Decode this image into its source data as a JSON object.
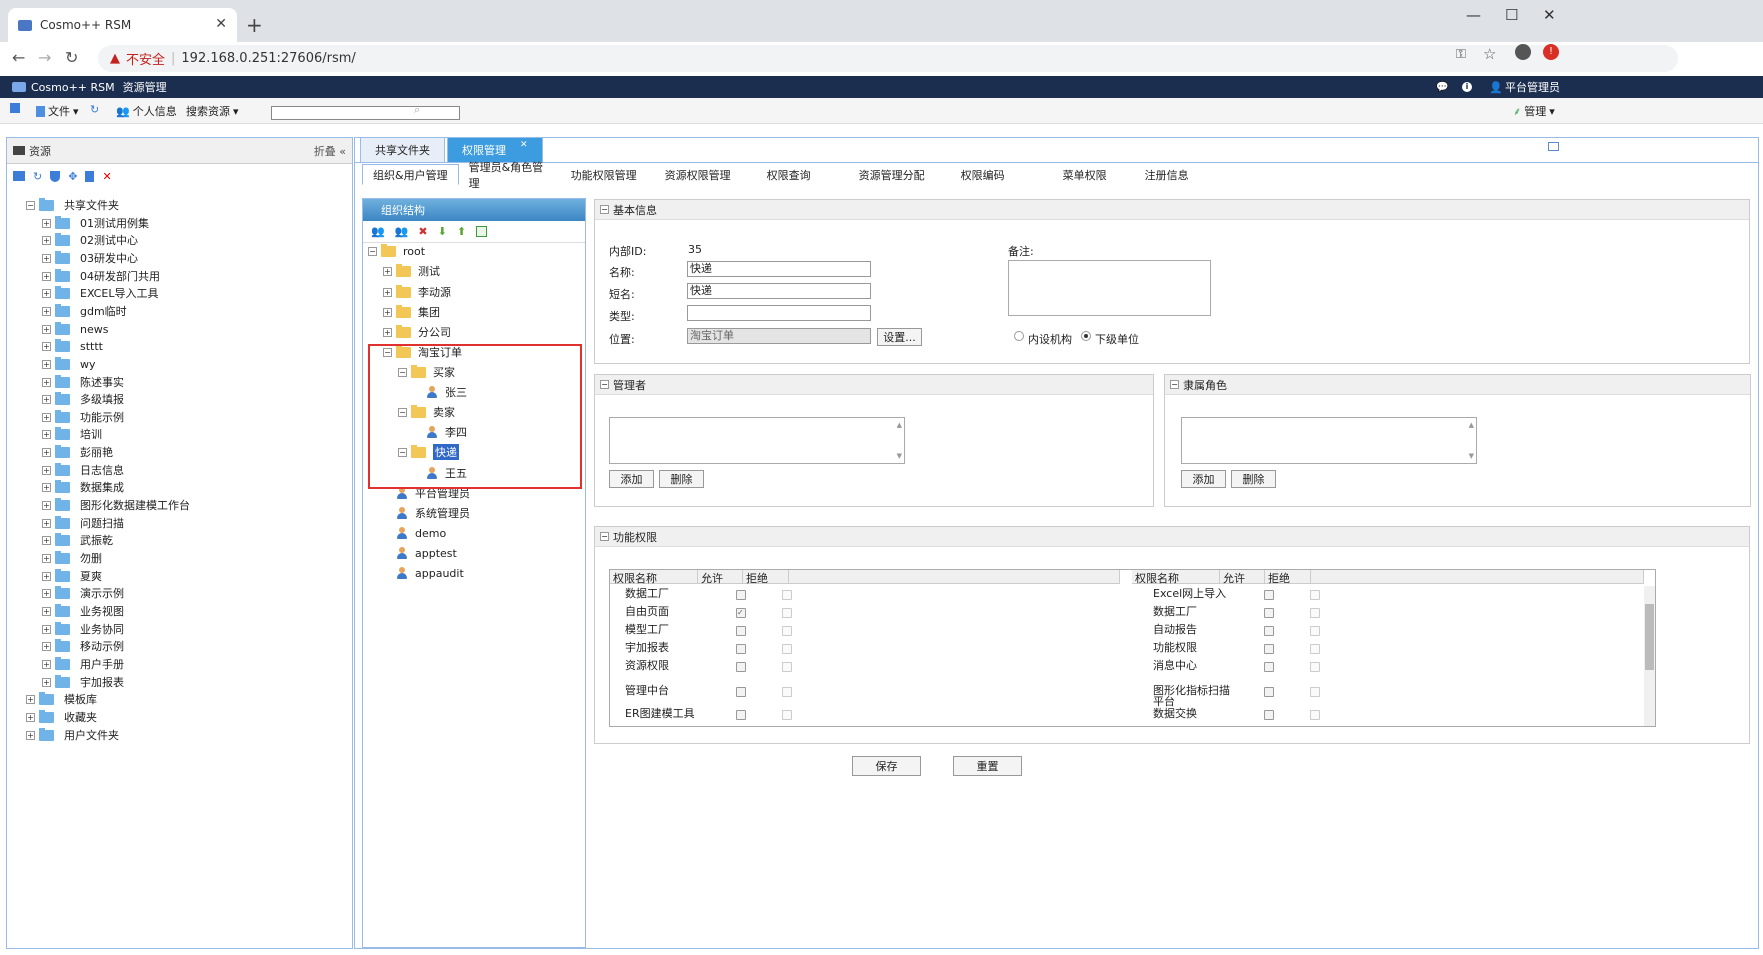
{
  "browser": {
    "tab_title": "Cosmo++ RSM",
    "security_label": "不安全",
    "url": "192.168.0.251:27606/rsm/"
  },
  "app": {
    "title": "Cosmo++ RSM",
    "module": "资源管理",
    "user": "平台管理员"
  },
  "toolbar": {
    "file": "文件",
    "profile": "个人信息",
    "search_label": "搜索资源",
    "search_value": "",
    "manage": "管理"
  },
  "left_panel": {
    "title": "资源",
    "collapse": "折叠",
    "items": [
      {
        "label": "共享文件夹"
      },
      {
        "label": "01测试用例集"
      },
      {
        "label": "02测试中心"
      },
      {
        "label": "03研发中心"
      },
      {
        "label": "04研发部门共用"
      },
      {
        "label": "EXCEL导入工具"
      },
      {
        "label": "gdm临时"
      },
      {
        "label": "news"
      },
      {
        "label": "stttt"
      },
      {
        "label": "wy"
      },
      {
        "label": "陈述事实"
      },
      {
        "label": "多级填报"
      },
      {
        "label": "功能示例"
      },
      {
        "label": "培训"
      },
      {
        "label": "彭丽艳"
      },
      {
        "label": "日志信息"
      },
      {
        "label": "数据集成"
      },
      {
        "label": "图形化数据建模工作台"
      },
      {
        "label": "问题扫描"
      },
      {
        "label": "武振乾"
      },
      {
        "label": "勿删"
      },
      {
        "label": "夏爽"
      },
      {
        "label": "演示示例"
      },
      {
        "label": "业务视图"
      },
      {
        "label": "业务协同"
      },
      {
        "label": "移动示例"
      },
      {
        "label": "用户手册"
      },
      {
        "label": "宇加报表"
      },
      {
        "label": "模板库"
      },
      {
        "label": "收藏夹"
      },
      {
        "label": "用户文件夹"
      }
    ]
  },
  "main_tabs": [
    "共享文件夹",
    "权限管理"
  ],
  "sub_tabs": [
    "组织&用户管理",
    "管理员&角色管理",
    "功能权限管理",
    "资源权限管理",
    "权限查询",
    "资源管理分配",
    "权限编码",
    "菜单权限",
    "注册信息"
  ],
  "org": {
    "title": "组织结构",
    "nodes": [
      "root",
      "测试",
      "李动源",
      "集团",
      "分公司",
      "淘宝订单",
      "买家",
      "张三",
      "卖家",
      "李四",
      "快递",
      "王五",
      "平台管理员",
      "系统管理员",
      "demo",
      "apptest",
      "appaudit"
    ]
  },
  "basic_info": {
    "title": "基本信息",
    "id_label": "内部ID:",
    "id_value": "35",
    "name_label": "名称:",
    "name_value": "快递",
    "short_label": "短名:",
    "short_value": "快递",
    "type_label": "类型:",
    "type_value": "",
    "position_label": "位置:",
    "position_value": "淘宝订单",
    "set_button": "设置...",
    "remark_label": "备注:",
    "radio_internal": "内设机构",
    "radio_sub": "下级单位"
  },
  "managers": {
    "title": "管理者",
    "add": "添加",
    "delete": "删除"
  },
  "roles": {
    "title": "隶属角色",
    "add": "添加",
    "delete": "删除"
  },
  "func_perm": {
    "title": "功能权限",
    "headers": [
      "权限名称",
      "允许",
      "拒绝"
    ],
    "left_rows": [
      {
        "name": "数据工厂",
        "allow": false
      },
      {
        "name": "自由页面",
        "allow": true
      },
      {
        "name": "模型工厂",
        "allow": false
      },
      {
        "name": "宇加报表",
        "allow": false
      },
      {
        "name": "资源权限",
        "allow": false
      },
      {
        "name": "管理中台",
        "allow": false
      },
      {
        "name": "ER图建模工具",
        "allow": false
      }
    ],
    "right_rows": [
      {
        "name": "Excel网上导入",
        "allow": false
      },
      {
        "name": "数据工厂",
        "allow": false
      },
      {
        "name": "自动报告",
        "allow": false
      },
      {
        "name": "功能权限",
        "allow": false
      },
      {
        "name": "消息中心",
        "allow": false
      },
      {
        "name": "图形化指标扫描平台",
        "allow": false
      },
      {
        "name": "数据交换",
        "allow": false
      }
    ]
  },
  "actions": {
    "save": "保存",
    "reset": "重置"
  }
}
